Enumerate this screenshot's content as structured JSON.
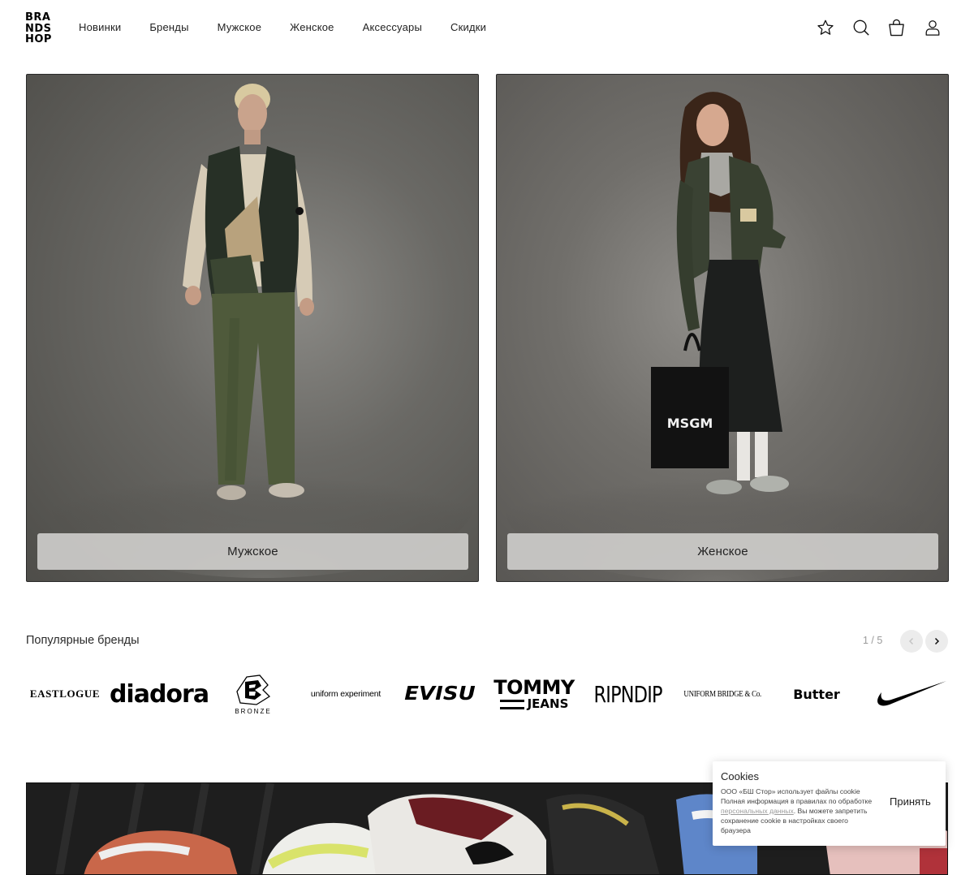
{
  "header": {
    "logo_lines": [
      "BRA",
      "NDS",
      "HOP"
    ],
    "nav": [
      "Новинки",
      "Бренды",
      "Мужское",
      "Женское",
      "Аксессуары",
      "Скидки"
    ],
    "icons": [
      "star-icon",
      "search-icon",
      "bag-icon",
      "user-icon"
    ]
  },
  "hero": {
    "men_label": "Мужское",
    "women_label": "Женское",
    "bag_text": "MSGM"
  },
  "brands": {
    "title": "Популярные бренды",
    "pager": "1 / 5",
    "items": [
      "EASTLOGUE",
      "diadora",
      "BRONZE",
      "uniform experiment",
      "EVISU",
      "TOMMY",
      "JEANS",
      "RIPNDIP",
      "UNIFORM BRIDGE & Co.",
      "Butter",
      "Nike"
    ]
  },
  "cookie": {
    "title": "Cookies",
    "text_before": "ООО «БШ Стор» использует файлы cookie Полная информация в правилах по обработке",
    "link": "персональных данных",
    "text_after": ". Вы можете запретить сохранение cookie в настройках своего браузера",
    "accept": "Принять"
  }
}
